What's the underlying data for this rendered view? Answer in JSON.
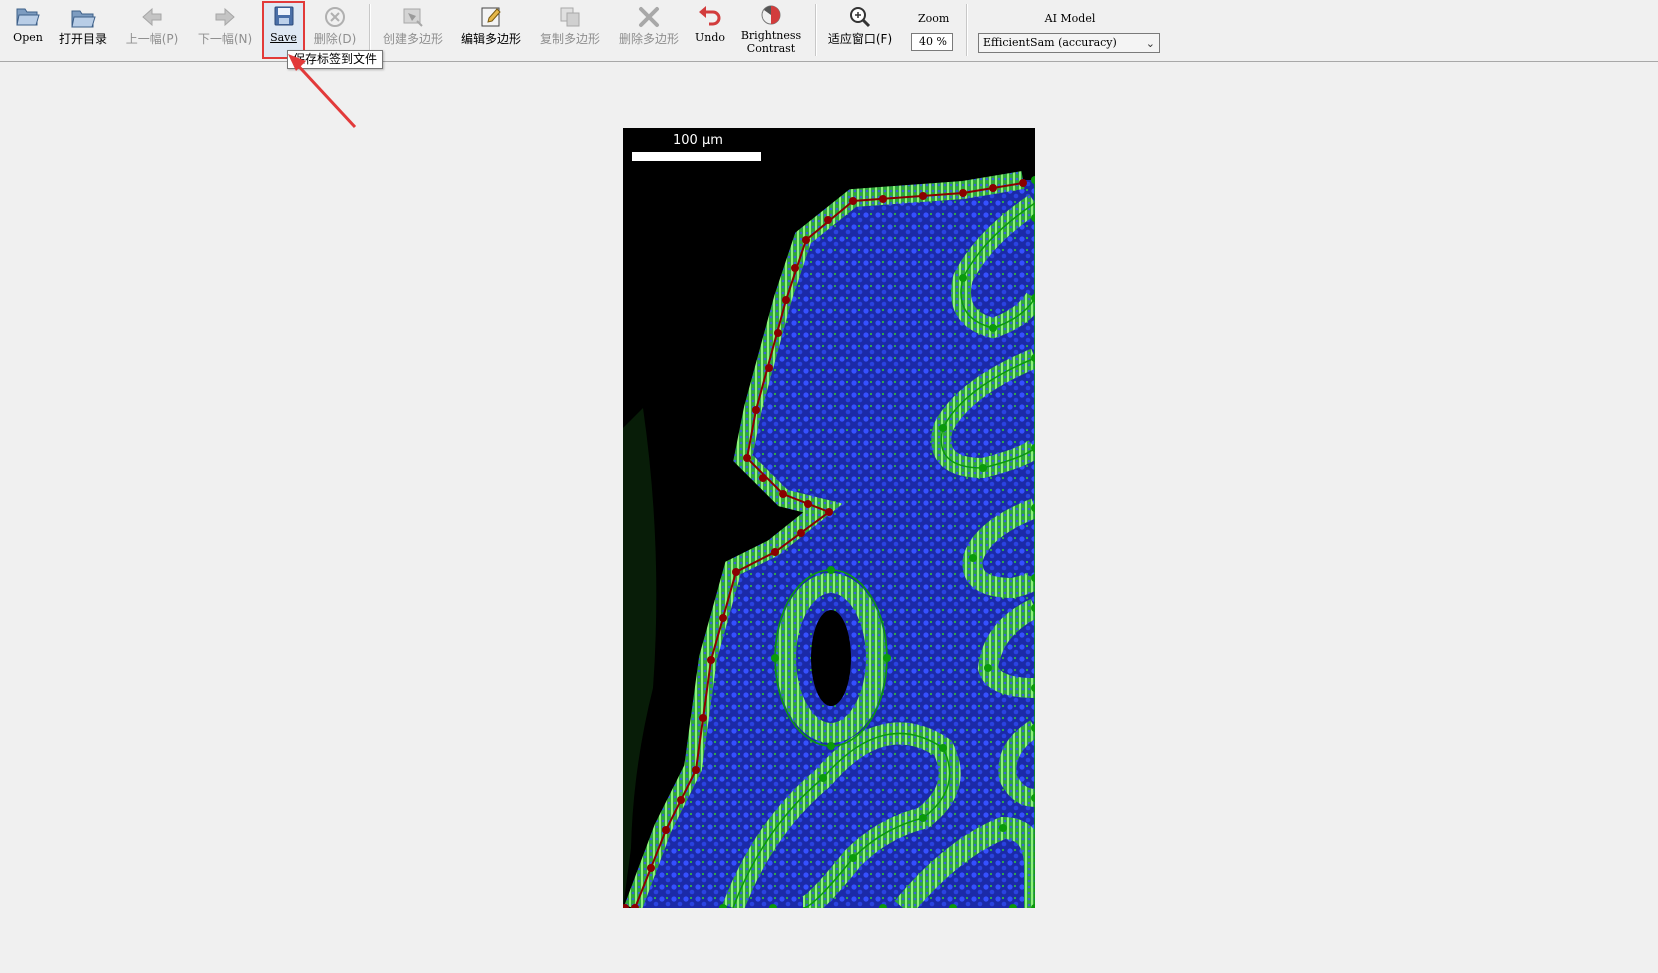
{
  "toolbar": {
    "buttons": [
      {
        "id": "open",
        "label": "Open",
        "icon": "folder-open-icon",
        "enabled": true
      },
      {
        "id": "open_dir",
        "label": "打开目录",
        "icon": "folder-open-icon",
        "enabled": true
      },
      {
        "id": "prev",
        "label": "上一幅(P)",
        "icon": "arrow-left-icon",
        "enabled": false
      },
      {
        "id": "next",
        "label": "下一幅(N)",
        "icon": "arrow-right-icon",
        "enabled": false
      },
      {
        "id": "save",
        "label": "Save",
        "icon": "floppy-disk-icon",
        "enabled": true
      },
      {
        "id": "delete",
        "label": "删除(D)",
        "icon": "circle-x-icon",
        "enabled": false
      },
      {
        "id": "create_polygon",
        "label": "创建多边形",
        "icon": "create-polygon-icon",
        "enabled": false
      },
      {
        "id": "edit_polygon",
        "label": "编辑多边形",
        "icon": "edit-polygon-icon",
        "enabled": true
      },
      {
        "id": "copy_polygon",
        "label": "复制多边形",
        "icon": "copy-polygon-icon",
        "enabled": false
      },
      {
        "id": "delete_polygon",
        "label": "删除多边形",
        "icon": "delete-polygon-icon",
        "enabled": false
      },
      {
        "id": "undo",
        "label": "Undo",
        "icon": "undo-arrow-icon",
        "enabled": true
      },
      {
        "id": "brightness_contrast",
        "label_line1": "Brightness",
        "label_line2": "Contrast",
        "icon": "brightness-contrast-icon",
        "enabled": true
      },
      {
        "id": "fit_window",
        "label": "适应窗口(F)",
        "icon": "zoom-fit-icon",
        "enabled": true
      }
    ],
    "zoom": {
      "label": "Zoom",
      "value": "40 %"
    },
    "ai_model": {
      "label": "AI Model",
      "selected": "EfficientSam (accuracy)"
    }
  },
  "tooltip": {
    "text": "保存标签到文件"
  },
  "image": {
    "scale_bar_label": "100 µm",
    "colors": {
      "background": "#000000",
      "nuclei": "#2a3fd6",
      "membrane": "#3fd23a",
      "polygon_red": "#8b0000",
      "polygon_green": "#0a9a0a"
    }
  },
  "annotation_colors": {
    "highlight_box": "#e23a3a",
    "arrow": "#e23a3a"
  }
}
